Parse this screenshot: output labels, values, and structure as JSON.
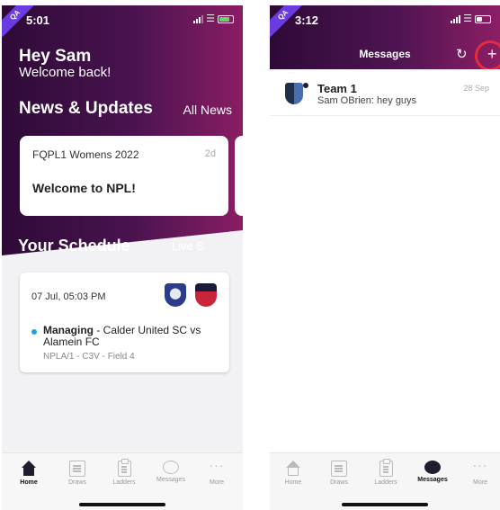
{
  "left": {
    "status": {
      "time": "5:01",
      "ribbon": "QA"
    },
    "greeting": {
      "title": "Hey Sam",
      "subtitle": "Welcome back!"
    },
    "news": {
      "section_title": "News & Updates",
      "link": "All News",
      "card": {
        "title": "FQPL1 Womens 2022",
        "age": "2d",
        "headline": "Welcome to NPL!"
      }
    },
    "schedule": {
      "section_title": "Your Schedule",
      "link": "Live S",
      "match": {
        "datetime": "07 Jul, 05:03 PM",
        "role": "Managing",
        "fixture": " - Calder United SC vs Alamein FC",
        "meta": "NPLA/1 - C3V - Field 4",
        "dot_color": "#1aa6e0"
      }
    },
    "tabs": [
      "Home",
      "Draws",
      "Ladders",
      "Messages",
      "More"
    ],
    "active_tab": "Home"
  },
  "right": {
    "status": {
      "time": "3:12",
      "ribbon": "QA"
    },
    "header": {
      "title": "Messages",
      "refresh_icon": "refresh-icon",
      "add_icon": "plus-icon",
      "highlight_color": "#e82a3c"
    },
    "threads": [
      {
        "name": "Team 1",
        "date": "28 Sep",
        "preview": "Sam OBrien: hey guys"
      }
    ],
    "tabs": [
      "Home",
      "Draws",
      "Ladders",
      "Messages",
      "More"
    ],
    "active_tab": "Messages"
  },
  "colors": {
    "header_start": "#2e0a37",
    "header_end": "#8c1e64",
    "accent": "#6a3be0"
  }
}
